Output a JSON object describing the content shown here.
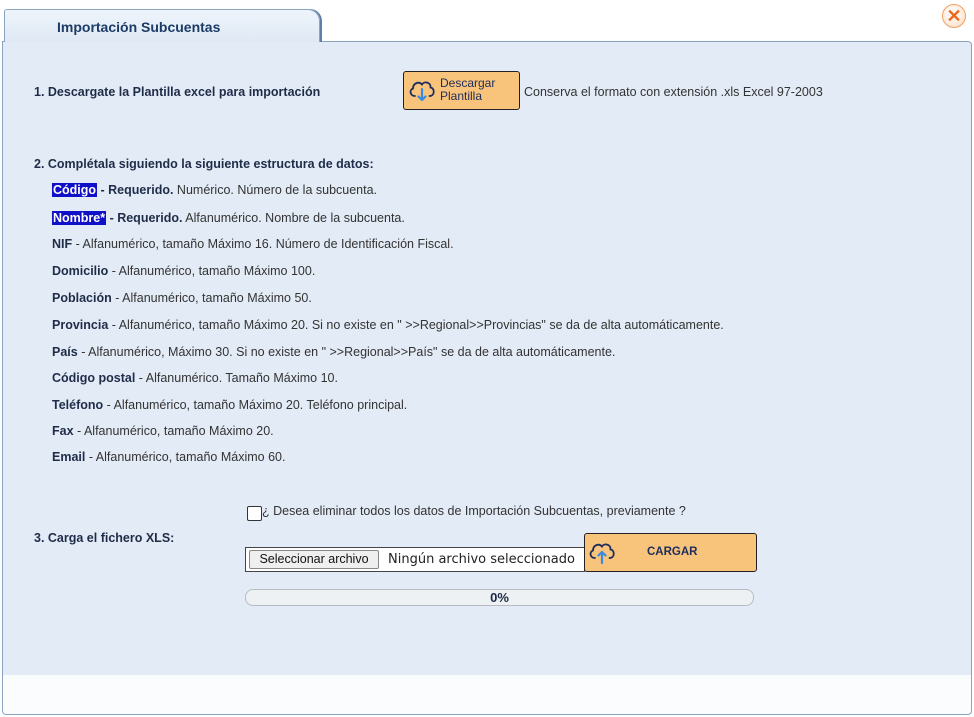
{
  "tab": {
    "title": "Importación Subcuentas"
  },
  "close": {
    "label": "✕"
  },
  "step1": {
    "label": "1. Descargate la Plantilla excel para importación",
    "button_line1": "Descargar",
    "button_line2": "Plantilla",
    "note": "Conserva el formato con extensión .xls Excel 97-2003"
  },
  "step2": {
    "label": "2. Complétala siguiendo la siguiente estructura de datos:",
    "fields": [
      {
        "name": "Código",
        "req": " - Requerido.",
        "desc": " Numérico. Número de la subcuenta."
      },
      {
        "name": "Nombre*",
        "req": " - Requerido.",
        "desc": " Alfanumérico. Nombre de la subcuenta."
      },
      {
        "name": "NIF",
        "desc": " - Alfanumérico, tamaño Máximo 16. Número de Identificación Fiscal."
      },
      {
        "name": "Domicilio",
        "desc": " - Alfanumérico, tamaño Máximo 100."
      },
      {
        "name": "Población",
        "desc": " - Alfanumérico, tamaño Máximo 50."
      },
      {
        "name": "Provincia",
        "desc": " - Alfanumérico, tamaño Máximo 20. Si no existe en \" >>Regional>>Provincias\" se da de alta automáticamente."
      },
      {
        "name": "País",
        "desc": " - Alfanumérico, Máximo 30. Si no existe en \" >>Regional>>País\" se da de alta automáticamente."
      },
      {
        "name": "Código postal",
        "desc": " - Alfanumérico. Tamaño Máximo 10."
      },
      {
        "name": "Teléfono",
        "desc": " - Alfanumérico, tamaño Máximo 20. Teléfono principal."
      },
      {
        "name": "Fax",
        "desc": " - Alfanumérico, tamaño Máximo 20."
      },
      {
        "name": "Email",
        "desc": " - Alfanumérico, tamaño Máximo 60."
      }
    ]
  },
  "step3": {
    "label": "3. Carga el fichero XLS:",
    "checkbox_label": "¿ Desea eliminar todos los datos de Importación Subcuentas, previamente ?",
    "file_button": "Seleccionar archivo",
    "file_status": "Ningún archivo seleccionado",
    "load_button": "CARGAR",
    "progress_text": "0%",
    "progress_value": 0
  },
  "colors": {
    "accent": "#f8c37a",
    "panel": "#e3ebf6",
    "highlight": "#1010c8"
  },
  "icons": {
    "download": "cloud-download-icon",
    "upload": "cloud-upload-icon",
    "close": "close-icon"
  }
}
